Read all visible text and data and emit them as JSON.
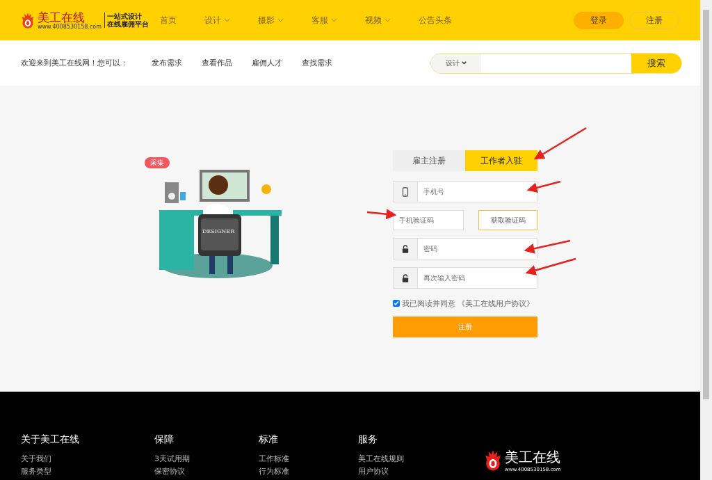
{
  "header": {
    "logo": {
      "name": "美工在线",
      "url": "www.4008530158.com",
      "tagline": [
        "一站式设计",
        "在线雇佣平台"
      ]
    },
    "nav": [
      {
        "label": "首页",
        "dropdown": false
      },
      {
        "label": "设计",
        "dropdown": true
      },
      {
        "label": "摄影",
        "dropdown": true
      },
      {
        "label": "客服",
        "dropdown": true
      },
      {
        "label": "视频",
        "dropdown": true
      },
      {
        "label": "公告头条",
        "dropdown": false
      }
    ],
    "login": "登录",
    "register": "注册"
  },
  "subbar": {
    "welcome": "欢迎来到美工在线网！您可以：",
    "links": [
      "发布需求",
      "查看作品",
      "雇佣人才",
      "查找需求"
    ],
    "search": {
      "category": "设计",
      "button": "搜索"
    }
  },
  "illustration": {
    "badge": "采集",
    "chair_text": "DESIGNER"
  },
  "form": {
    "tabs": [
      {
        "label": "雇主注册",
        "selected": false
      },
      {
        "label": "工作者入驻",
        "selected": true
      }
    ],
    "fields": [
      {
        "kind": "phone",
        "placeholder": "手机号"
      },
      {
        "kind": "code",
        "placeholder": "手机验证码",
        "button": "获取验证码"
      },
      {
        "kind": "password",
        "placeholder": "密码"
      },
      {
        "kind": "password",
        "placeholder": "再次输入密码"
      }
    ],
    "agreement": {
      "checked": true,
      "text": "我已阅读并同意 《美工在线用户协议》"
    },
    "submit": "注册"
  },
  "footer": {
    "columns": [
      {
        "title": "关于美工在线",
        "links": [
          "关于我们",
          "服务类型"
        ]
      },
      {
        "title": "保障",
        "links": [
          "3天试用期",
          "保密协议"
        ]
      },
      {
        "title": "标准",
        "links": [
          "工作标准",
          "行为标准"
        ]
      },
      {
        "title": "服务",
        "links": [
          "美工在线规则",
          "用户协议"
        ]
      }
    ],
    "logo": {
      "name": "美工在线",
      "url": "www.4008530158.com"
    }
  }
}
